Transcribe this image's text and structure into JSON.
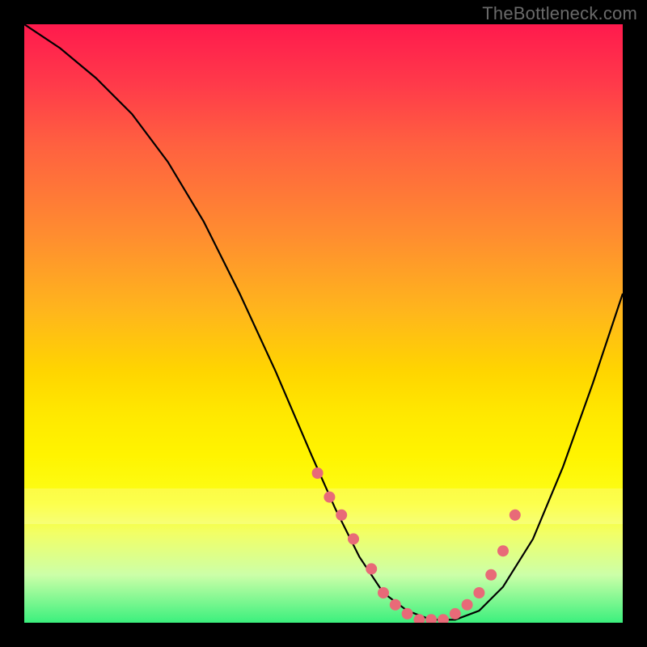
{
  "attribution": "TheBottleneck.com",
  "chart_data": {
    "type": "line",
    "title": "",
    "xlabel": "",
    "ylabel": "",
    "xlim": [
      0,
      100
    ],
    "ylim": [
      0,
      100
    ],
    "grid": false,
    "legend": false,
    "series": [
      {
        "name": "curve",
        "x": [
          0,
          6,
          12,
          18,
          24,
          30,
          36,
          42,
          48,
          52,
          56,
          60,
          64,
          68,
          72,
          76,
          80,
          85,
          90,
          95,
          100
        ],
        "y": [
          100,
          96,
          91,
          85,
          77,
          67,
          55,
          42,
          28,
          19,
          11,
          5,
          2,
          0.5,
          0.5,
          2,
          6,
          14,
          26,
          40,
          55
        ]
      }
    ],
    "markers": {
      "name": "dots",
      "color": "#e86a78",
      "x": [
        49,
        51,
        53,
        55,
        58,
        60,
        62,
        64,
        66,
        68,
        70,
        72,
        74,
        76,
        78,
        80,
        82
      ],
      "y": [
        25,
        21,
        18,
        14,
        9,
        5,
        3,
        1.5,
        0.5,
        0.5,
        0.5,
        1.5,
        3,
        5,
        8,
        12,
        18
      ]
    },
    "background_gradient": {
      "stops": [
        {
          "pos": 0,
          "color": "#ff1a4d"
        },
        {
          "pos": 35,
          "color": "#ff8c30"
        },
        {
          "pos": 58,
          "color": "#ffd500"
        },
        {
          "pos": 85,
          "color": "#f2ff66"
        },
        {
          "pos": 100,
          "color": "#3bf07d"
        }
      ],
      "pale_band_y": [
        77.5,
        83.5
      ]
    }
  }
}
